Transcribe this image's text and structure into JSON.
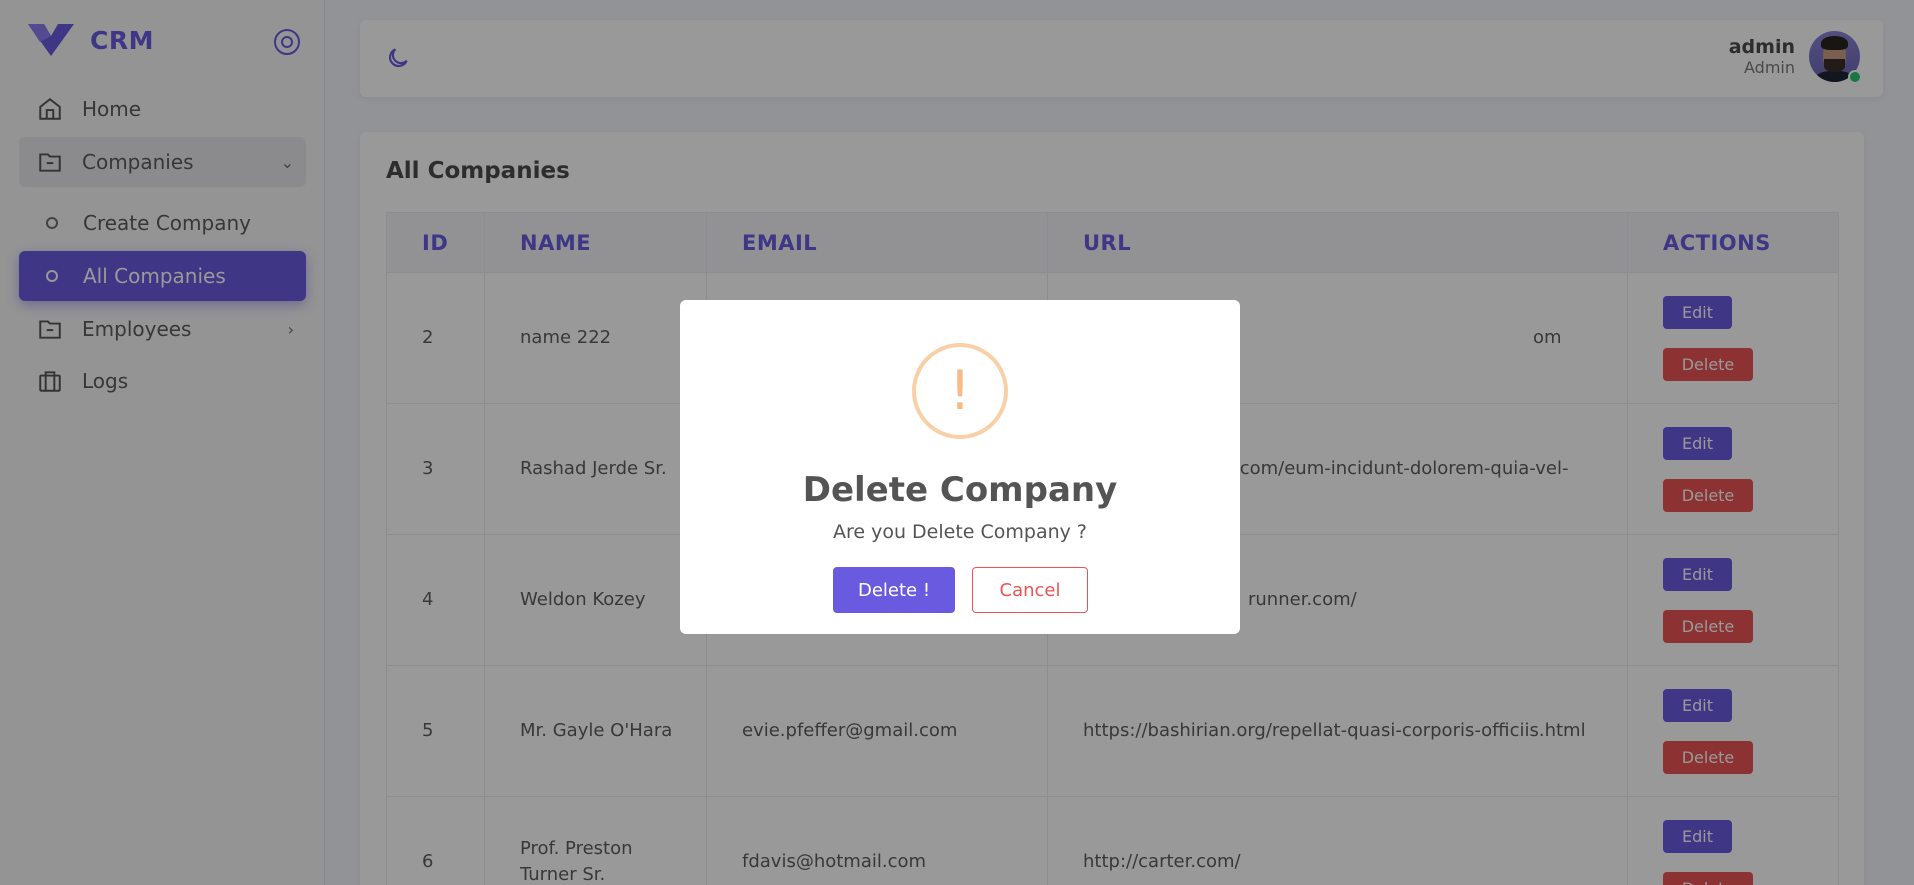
{
  "brand": {
    "name": "CRM",
    "logo_icon": "v-logo-icon",
    "toggle_icon": "circle-target-icon"
  },
  "sidebar": {
    "items": [
      {
        "label": "Home",
        "icon": "home-icon"
      },
      {
        "label": "Companies",
        "icon": "folder-icon",
        "expanded": true
      },
      {
        "label": "Create Company",
        "icon": "circle-icon"
      },
      {
        "label": "All Companies",
        "icon": "circle-icon",
        "active": true
      },
      {
        "label": "Employees",
        "icon": "folder-icon"
      },
      {
        "label": "Logs",
        "icon": "briefcase-icon"
      }
    ]
  },
  "header": {
    "theme_icon": "moon-icon",
    "user_name": "admin",
    "user_role": "Admin",
    "status": "online"
  },
  "page": {
    "title": "All Companies",
    "columns": [
      "ID",
      "NAME",
      "EMAIL",
      "URL",
      "ACTIONS"
    ],
    "rows": [
      {
        "id": "2",
        "name": "name 222",
        "email": "",
        "url": "om"
      },
      {
        "id": "3",
        "name": "Rashad Jerde Sr.",
        "email": "",
        "url": ".com/eum-incidunt-dolorem-quia-vel-"
      },
      {
        "id": "4",
        "name": "Weldon Kozey",
        "email": "",
        "url": "runner.com/"
      },
      {
        "id": "5",
        "name": "Mr. Gayle O'Hara",
        "email": "evie.pfeffer@gmail.com",
        "url": "https://bashirian.org/repellat-quasi-corporis-officiis.html"
      },
      {
        "id": "6",
        "name": "Prof. Preston Turner Sr.",
        "email": "fdavis@hotmail.com",
        "url": "http://carter.com/"
      }
    ],
    "edit_label": "Edit",
    "delete_label": "Delete"
  },
  "modal": {
    "icon": "warning-icon",
    "icon_glyph": "!",
    "title": "Delete Company",
    "text": "Are you Delete Company ?",
    "confirm_label": "Delete !",
    "cancel_label": "Cancel"
  },
  "colors": {
    "accent": "#6a5ae0",
    "danger": "#ea5455",
    "warning": "#f8bb86"
  }
}
